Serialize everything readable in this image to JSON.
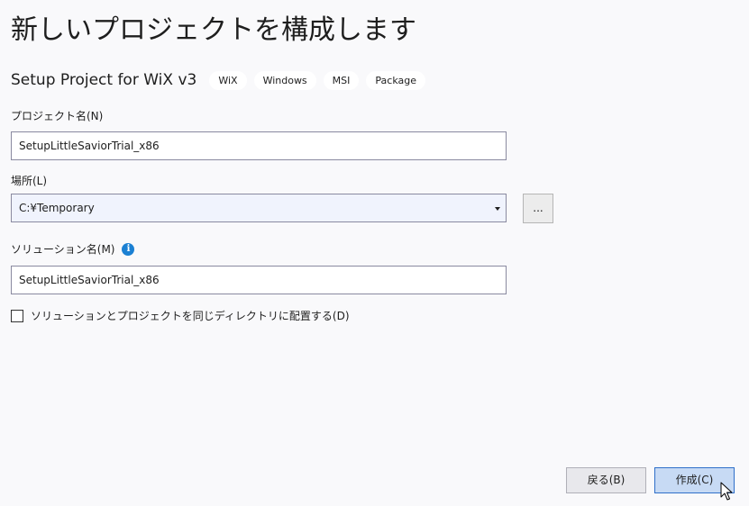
{
  "title": "新しいプロジェクトを構成します",
  "template": {
    "name": "Setup Project for WiX v3",
    "tags": [
      "WiX",
      "Windows",
      "MSI",
      "Package"
    ]
  },
  "project_name": {
    "label": "プロジェクト名(N)",
    "value": "SetupLittleSaviorTrial_x86"
  },
  "location": {
    "label": "場所(L)",
    "value": "C:¥Temporary",
    "browse_label": "..."
  },
  "solution_name": {
    "label": "ソリューション名(M)",
    "value": "SetupLittleSaviorTrial_x86"
  },
  "same_directory": {
    "label": "ソリューションとプロジェクトを同じディレクトリに配置する(D)",
    "checked": false
  },
  "buttons": {
    "back": "戻る(B)",
    "create": "作成(C)"
  },
  "colors": {
    "background": "#f9f9fb",
    "accent": "#1b80d3",
    "primary_button": "#c7daf4"
  },
  "icons": {
    "info": "info-icon",
    "dropdown": "chevron-down-icon",
    "cursor": "mouse-pointer-icon"
  }
}
